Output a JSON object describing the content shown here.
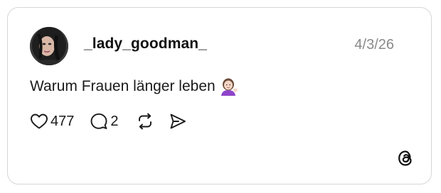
{
  "post": {
    "username": "_lady_goodman_",
    "date": "4/3/26",
    "text": "Warum Frauen länger leben",
    "text_emoji": "woman-tipping-hand-emoji",
    "likes": "477",
    "replies": "2"
  },
  "icons": {
    "like": "heart-icon",
    "reply": "speech-bubble-icon",
    "repost": "repost-icon",
    "share": "send-icon",
    "brand": "threads-logo"
  },
  "colors": {
    "text": "#1a1a1a",
    "muted": "#8a8a8a",
    "border": "#d6d6d6",
    "emoji_shirt": "#8e44c9"
  }
}
